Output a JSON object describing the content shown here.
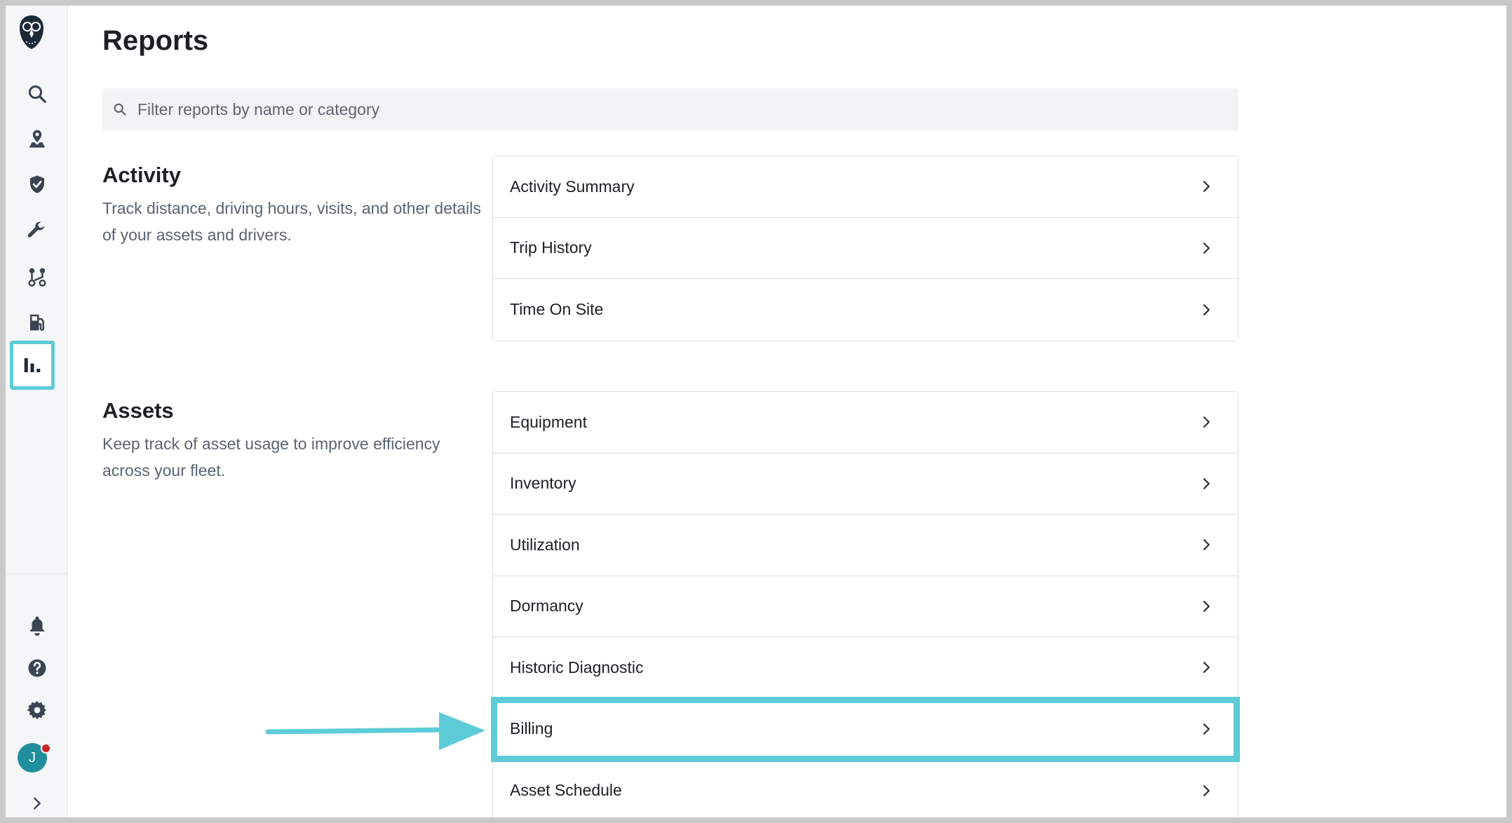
{
  "page": {
    "title": "Reports",
    "search_placeholder": "Filter reports by name or category"
  },
  "sidebar": {
    "active_item": "reports",
    "avatar_initial": "J",
    "accent_color": "#5ecbd8"
  },
  "sections": [
    {
      "title": "Activity",
      "description": "Track distance, driving hours, visits, and other details of your assets and drivers.",
      "items": [
        "Activity Summary",
        "Trip History",
        "Time On Site"
      ]
    },
    {
      "title": "Assets",
      "description": "Keep track of asset usage to improve efficiency across your fleet.",
      "items": [
        "Equipment",
        "Inventory",
        "Utilization",
        "Dormancy",
        "Historic Diagnostic",
        "Billing",
        "Asset Schedule"
      ]
    }
  ],
  "highlighted_item": "Billing"
}
